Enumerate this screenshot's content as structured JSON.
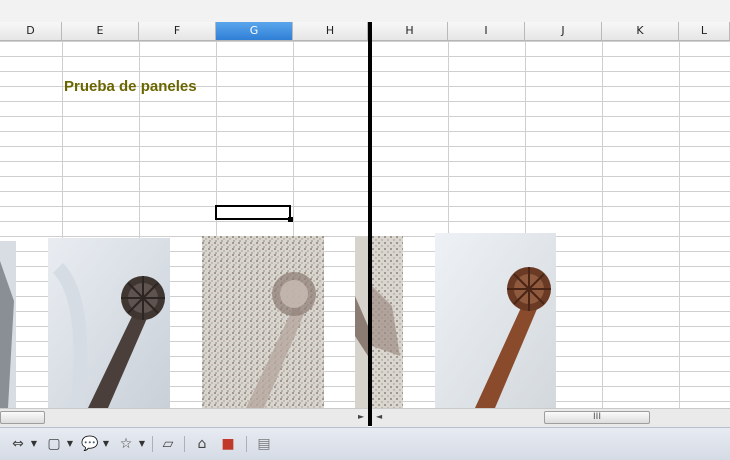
{
  "left_pane": {
    "columns": [
      {
        "label": "D",
        "selected": false
      },
      {
        "label": "E",
        "selected": false
      },
      {
        "label": "F",
        "selected": false
      },
      {
        "label": "G",
        "selected": true
      },
      {
        "label": "H",
        "selected": false
      }
    ],
    "cell_text": "Prueba de paneles"
  },
  "right_pane": {
    "columns": [
      {
        "label": "H"
      },
      {
        "label": "I"
      },
      {
        "label": "J"
      },
      {
        "label": "K"
      },
      {
        "label": "L"
      }
    ]
  },
  "images": [
    {
      "name": "photo-original",
      "effect": "normal"
    },
    {
      "name": "photo-noise",
      "effect": "noise"
    },
    {
      "name": "photo-cropped",
      "effect": "noise"
    },
    {
      "name": "photo-warm",
      "effect": "normal"
    }
  ],
  "scrollbar": {
    "grip_label": "III"
  },
  "toolbar": {
    "icons": [
      "arrows-icon",
      "rectangle-icon",
      "callout-icon",
      "star-icon",
      "polygon-icon",
      "camera-icon",
      "picture-icon",
      "layers-icon"
    ]
  },
  "colors": {
    "selected_header": "#2f7fd6",
    "cell_text": "#6b6500",
    "splitter": "#000000"
  }
}
